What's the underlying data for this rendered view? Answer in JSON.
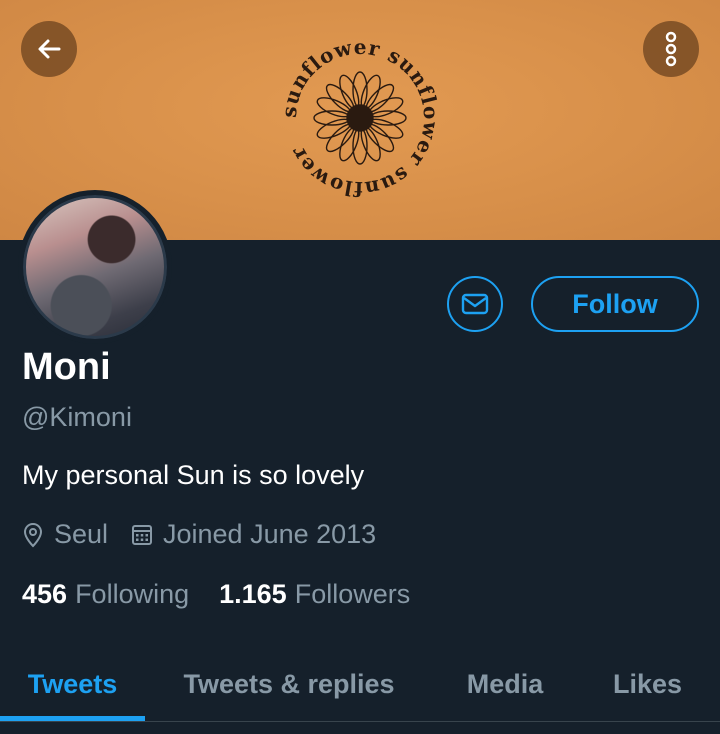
{
  "header": {
    "back_icon": "arrow-left-icon",
    "more_icon": "vertical-dots-icon",
    "banner_text": "sunflower sunflower sunflower"
  },
  "profile": {
    "name": "Moni",
    "handle": "@Kimoni",
    "bio": "My personal Sun is so lovely",
    "location": "Seul",
    "joined": "Joined June 2013",
    "following_count": "456",
    "following_label": "Following",
    "followers_count": "1.165",
    "followers_label": "Followers"
  },
  "actions": {
    "message_icon": "envelope-icon",
    "follow_label": "Follow"
  },
  "tabs": [
    {
      "label": "Tweets",
      "active": true
    },
    {
      "label": "Tweets & replies",
      "active": false
    },
    {
      "label": "Media",
      "active": false
    },
    {
      "label": "Likes",
      "active": false
    }
  ],
  "colors": {
    "background": "#15202b",
    "accent": "#1da1f2",
    "banner": "#d8904a",
    "muted_text": "#8899a6"
  }
}
